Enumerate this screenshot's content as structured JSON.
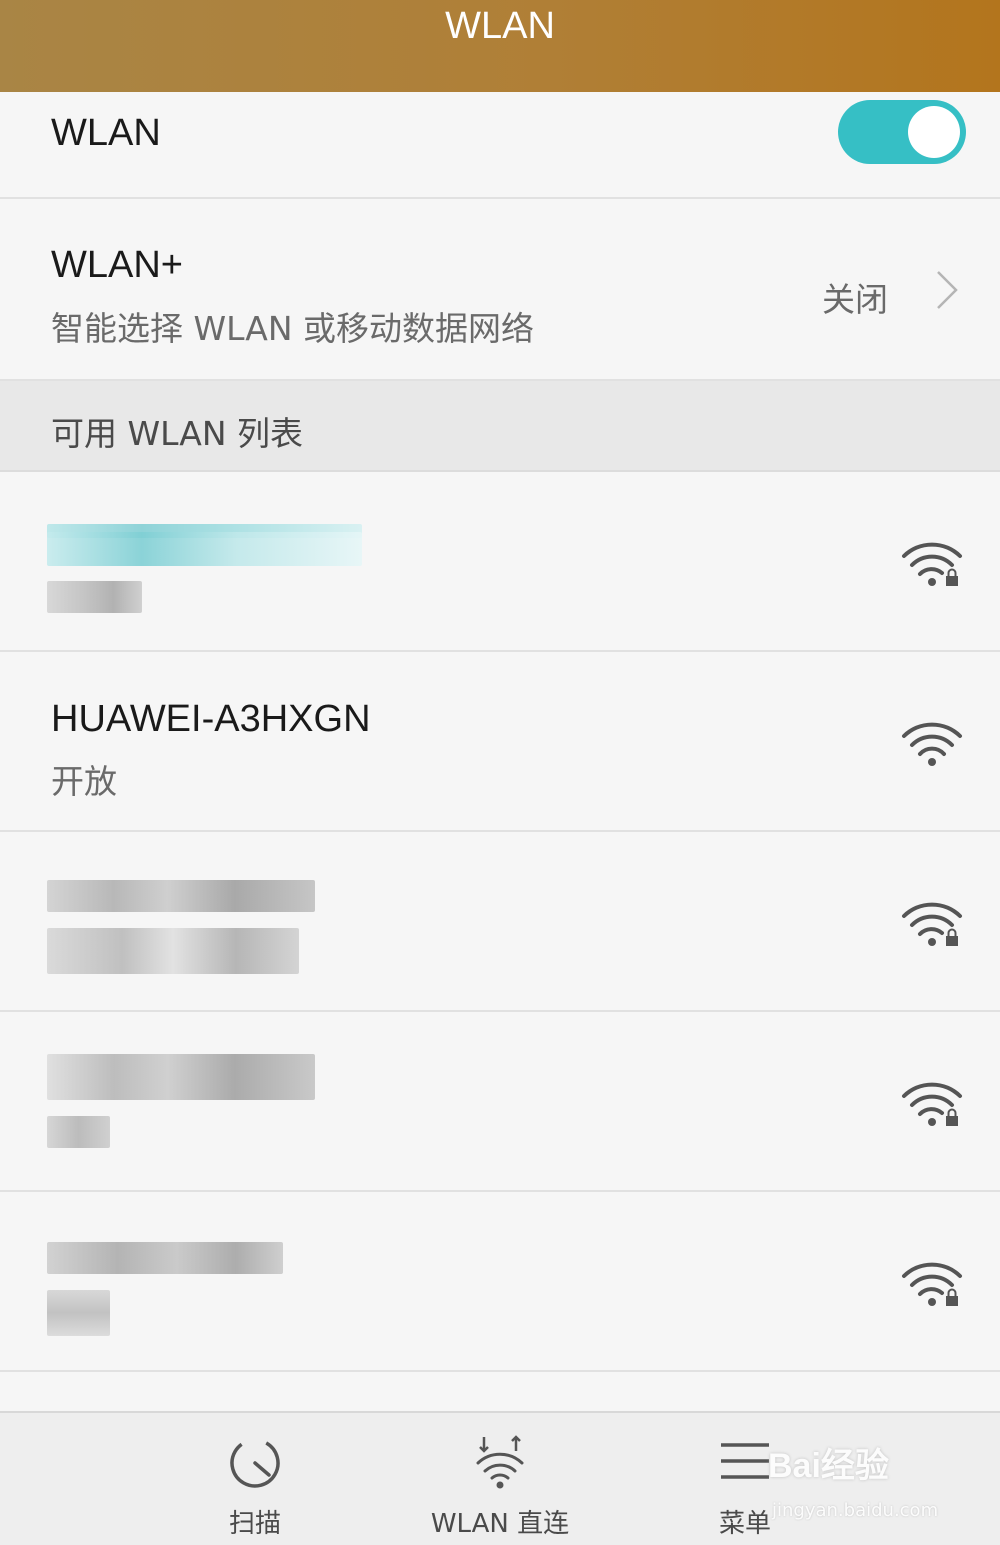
{
  "header": {
    "title": "WLAN"
  },
  "wlan_toggle": {
    "label": "WLAN",
    "enabled": true,
    "accent_color": "#36bfc5"
  },
  "wlan_plus": {
    "title": "WLAN+",
    "subtitle": "智能选择 WLAN 或移动数据网络",
    "state": "关闭"
  },
  "section": {
    "title": "可用 WLAN 列表"
  },
  "networks": [
    {
      "ssid": "",
      "security": "",
      "redacted": true,
      "locked": true
    },
    {
      "ssid": "HUAWEI-A3HXGN",
      "security": "开放",
      "redacted": false,
      "locked": false
    },
    {
      "ssid": "",
      "security": "",
      "redacted": true,
      "locked": true
    },
    {
      "ssid": "",
      "security": "",
      "redacted": true,
      "locked": true
    },
    {
      "ssid": "",
      "security": "",
      "redacted": true,
      "locked": true
    }
  ],
  "bottom_bar": {
    "scan": {
      "label": "扫描",
      "icon": "scan-icon"
    },
    "direct": {
      "label": "WLAN 直连",
      "icon": "wifi-direct-icon"
    },
    "menu": {
      "label": "菜单",
      "icon": "menu-icon"
    }
  },
  "watermark": {
    "brand": "Bai经验",
    "url": "jingyan.baidu.com"
  }
}
